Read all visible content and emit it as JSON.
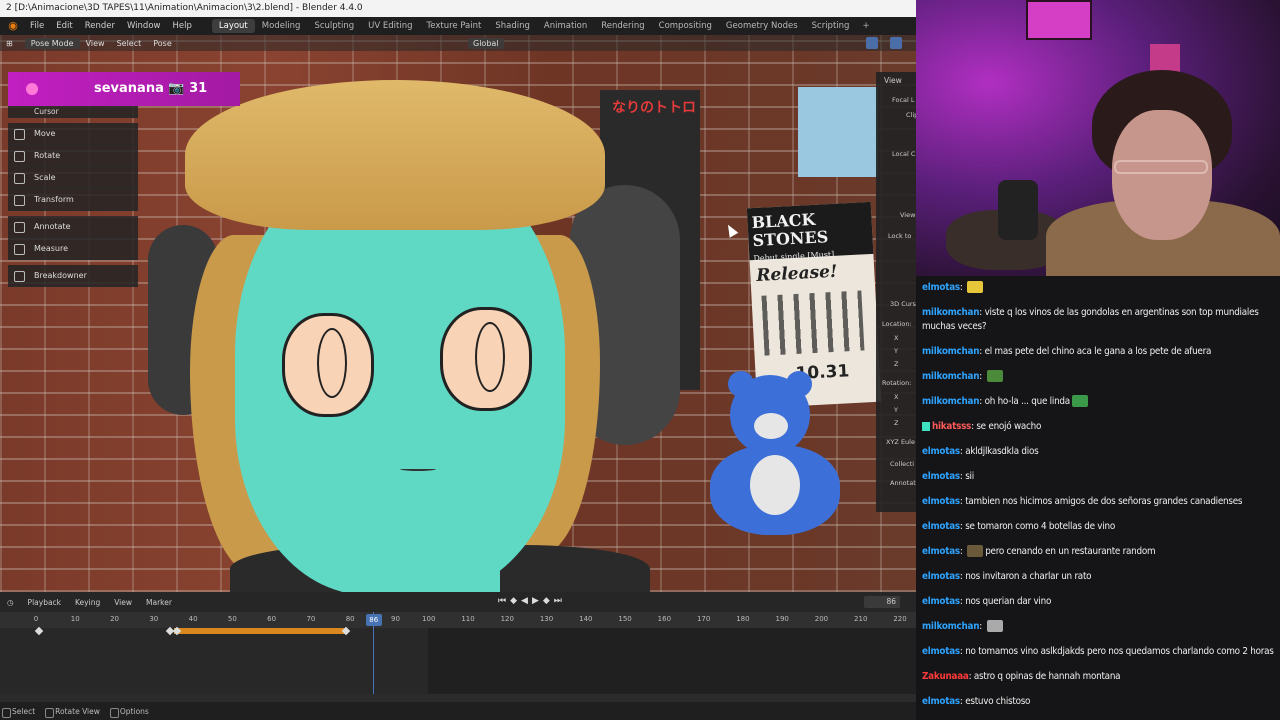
{
  "blender": {
    "title": "2 [D:\\Animacione\\3D TAPES\\11\\Animation\\Animacion\\3\\2.blend] - Blender 4.4.0",
    "menu": [
      "File",
      "Edit",
      "Render",
      "Window",
      "Help"
    ],
    "workspaces": [
      "Layout",
      "Modeling",
      "Sculpting",
      "UV Editing",
      "Texture Paint",
      "Shading",
      "Animation",
      "Rendering",
      "Compositing",
      "Geometry Nodes",
      "Scripting"
    ],
    "active_workspace": "Layout",
    "viewport_header": {
      "mode": "Pose Mode",
      "items": [
        "View",
        "Select",
        "Pose"
      ],
      "orientation": "Global"
    },
    "tools": {
      "cursor": "Cursor",
      "move": "Move",
      "rotate": "Rotate",
      "scale": "Scale",
      "transform": "Transform",
      "annotate": "Annotate",
      "measure": "Measure",
      "breakdowner": "Breakdowner"
    },
    "sidebar": {
      "view_tab": "View",
      "focal": "Focal L",
      "clip": "Clip",
      "local": "Local C",
      "view2": "View",
      "lock_to": "Lock to",
      "cursor3d": "3D Curs",
      "location": "Location:",
      "x": "X",
      "y": "Y",
      "z": "Z",
      "rotation": "Rotation:",
      "rx": "X",
      "ry": "Y",
      "rz": "Z",
      "xyz_euler": "XYZ Eule",
      "collections": "Collecti",
      "annotations": "Annotat"
    },
    "scene": {
      "poster_totoro_text": "なりのトトロ",
      "poster_bs_title": "BLACK STONES",
      "poster_bs_sub": "Debut single [Must]",
      "poster_bs_release": "Release!",
      "poster_bs_date": "10.31"
    },
    "banner": "sevanana 📷 31",
    "timeline": {
      "menus": [
        "Playback",
        "Keying",
        "View",
        "Marker"
      ],
      "current_frame": "86",
      "ruler": [
        "0",
        "10",
        "20",
        "30",
        "40",
        "50",
        "60",
        "70",
        "80",
        "90",
        "100",
        "110",
        "120",
        "130",
        "140",
        "150",
        "160",
        "170",
        "180",
        "190",
        "200",
        "210",
        "220"
      ],
      "playhead_label": "86"
    },
    "status": [
      "Select",
      "Rotate View",
      "Options"
    ]
  },
  "chat": [
    {
      "user": "elmotas",
      "color": "#2ea3ff",
      "text": "",
      "emote": "#e8c63a"
    },
    {
      "user": "milkomchan",
      "color": "#2ea3ff",
      "text": "viste q los vinos de las gondolas en argentinas son top mundiales muchas veces?"
    },
    {
      "user": "milkomchan",
      "color": "#2ea3ff",
      "text": "el mas pete del chino aca le gana a los pete de afuera"
    },
    {
      "user": "milkomchan",
      "color": "#2ea3ff",
      "text": "",
      "emote": "#4a8a3a"
    },
    {
      "user": "milkomchan",
      "color": "#2ea3ff",
      "text": "oh ho-la ... que linda",
      "emote": "#3a9a4a"
    },
    {
      "user": "hikatsss",
      "color": "#ff5a5a",
      "text": "se enojó wacho",
      "badge": true
    },
    {
      "user": "elmotas",
      "color": "#2ea3ff",
      "text": "akldjlkasdkla dios"
    },
    {
      "user": "elmotas",
      "color": "#2ea3ff",
      "text": "sii"
    },
    {
      "user": "elmotas",
      "color": "#2ea3ff",
      "text": "tambien nos hicimos amigos de dos señoras grandes canadienses"
    },
    {
      "user": "elmotas",
      "color": "#2ea3ff",
      "text": "se tomaron como 4 botellas de vino"
    },
    {
      "user": "elmotas",
      "color": "#2ea3ff",
      "text": "pero cenando en un restaurante random",
      "emote_before": "#6a5a3a"
    },
    {
      "user": "elmotas",
      "color": "#2ea3ff",
      "text": "nos invitaron a charlar un rato"
    },
    {
      "user": "elmotas",
      "color": "#2ea3ff",
      "text": "nos querian dar vino"
    },
    {
      "user": "milkomchan",
      "color": "#2ea3ff",
      "text": "",
      "emote": "#aaaaaa"
    },
    {
      "user": "elmotas",
      "color": "#2ea3ff",
      "text": "no tomamos vino aslkdjakds pero nos quedamos charlando como 2 horas"
    },
    {
      "user": "Zakunaaa",
      "color": "#ff3a3a",
      "text": "astro q opinas de hannah montana"
    },
    {
      "user": "elmotas",
      "color": "#2ea3ff",
      "text": "estuvo chistoso"
    }
  ]
}
